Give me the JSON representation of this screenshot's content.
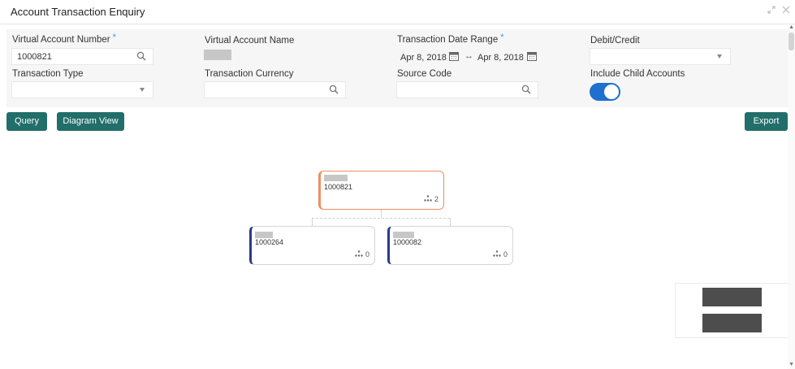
{
  "window": {
    "title": "Account Transaction Enquiry",
    "controls": [
      "expand-icon",
      "close-icon"
    ]
  },
  "filters": {
    "virtual_account_number": {
      "label": "Virtual Account Number",
      "required": true,
      "value": "1000821",
      "icon": "search-icon"
    },
    "virtual_account_name": {
      "label": "Virtual Account Name",
      "value_redacted": true
    },
    "transaction_date_range": {
      "label": "Transaction Date Range",
      "required": true,
      "from": "Apr 8, 2018",
      "to": "Apr 8, 2018",
      "separator": "↔",
      "icon": "calendar-icon"
    },
    "debit_credit": {
      "label": "Debit/Credit",
      "value": ""
    },
    "transaction_type": {
      "label": "Transaction Type",
      "value": ""
    },
    "transaction_currency": {
      "label": "Transaction Currency",
      "value": "",
      "icon": "search-icon"
    },
    "source_code": {
      "label": "Source Code",
      "value": "",
      "icon": "search-icon"
    },
    "include_child_accounts": {
      "label": "Include Child Accounts",
      "on": true
    }
  },
  "actions": {
    "query": "Query",
    "diagram_view": "Diagram View",
    "export": "Export"
  },
  "diagram": {
    "root": {
      "account": "1000821",
      "child_count": "2"
    },
    "children": [
      {
        "account": "1000264",
        "child_count": "0"
      },
      {
        "account": "1000082",
        "child_count": "0"
      }
    ]
  },
  "colors": {
    "accent_button": "#216e6a",
    "toggle_on": "#1e6fd0",
    "root_node_border": "#f08d5e",
    "child_node_border": "#2b3a8a",
    "required_marker": "#2f9bd8"
  }
}
